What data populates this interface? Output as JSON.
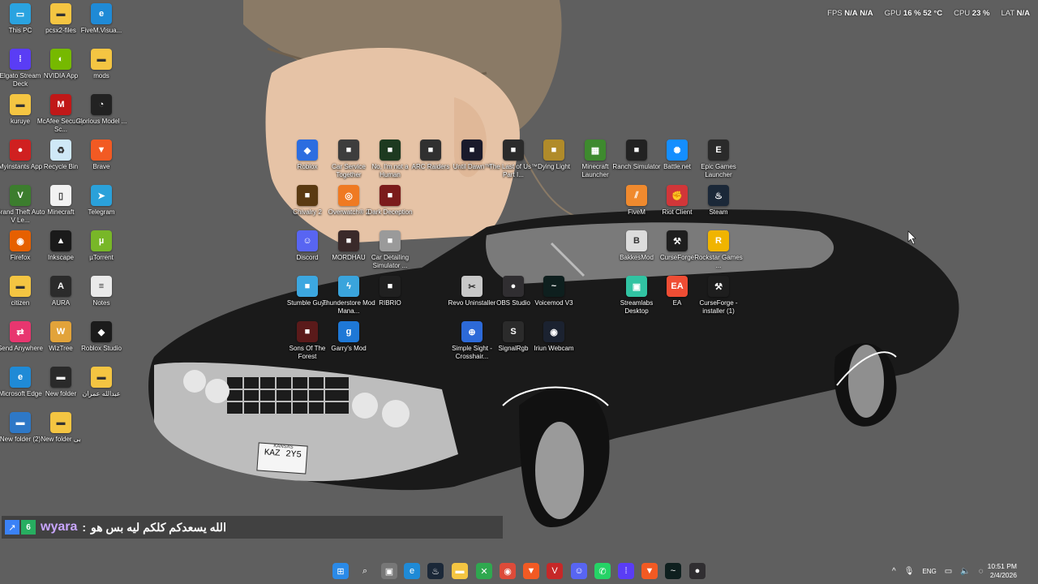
{
  "overlay": {
    "fps_label": "FPS",
    "fps_value": "N/A",
    "fps_value2": "N/A",
    "gpu_label": "GPU",
    "gpu_load": "16 %",
    "gpu_temp": "52 °C",
    "cpu_label": "CPU",
    "cpu_load": "23 %",
    "lat_label": "LAT",
    "lat_value": "N/A"
  },
  "desktop_icons": [
    {
      "label": "This PC",
      "icon": "pc-icon",
      "color": "#2aa3e0"
    },
    {
      "label": "pcsx2-files",
      "icon": "folder-icon",
      "color": "#f4c542"
    },
    {
      "label": "FiveM.Visua...",
      "icon": "edge-icon",
      "color": "#1f8ad6"
    },
    {
      "label": "Elgato Stream Deck",
      "icon": "grid-icon",
      "color": "#5a3df5"
    },
    {
      "label": "NVIDIA App",
      "icon": "nvidia-icon",
      "color": "#76b900"
    },
    {
      "label": "mods",
      "icon": "folder-icon",
      "color": "#f4c542"
    },
    {
      "label": "kuruye",
      "icon": "folder-icon",
      "color": "#f4c542"
    },
    {
      "label": "McAfee Security Sc...",
      "icon": "mcafee-icon",
      "color": "#c01818"
    },
    {
      "label": "Glorious Model ...",
      "icon": "mouse-icon",
      "color": "#222222"
    },
    {
      "label": "Myinstants App",
      "icon": "button-icon",
      "color": "#d02020"
    },
    {
      "label": "Recycle Bin",
      "icon": "recycle-icon",
      "color": "#cfe8f7"
    },
    {
      "label": "Brave",
      "icon": "brave-icon",
      "color": "#f25a23"
    },
    {
      "label": "Grand Theft Auto V Le...",
      "icon": "gta-icon",
      "color": "#3c7d2e"
    },
    {
      "label": "Minecraft",
      "icon": "file-icon",
      "color": "#f2f2f2"
    },
    {
      "label": "Telegram",
      "icon": "telegram-icon",
      "color": "#2aa1da"
    },
    {
      "label": "Firefox",
      "icon": "firefox-icon",
      "color": "#e66000"
    },
    {
      "label": "Inkscape",
      "icon": "inkscape-icon",
      "color": "#1a1a1a"
    },
    {
      "label": "µTorrent",
      "icon": "torrent-icon",
      "color": "#78b728"
    },
    {
      "label": "citizen",
      "icon": "folder-icon",
      "color": "#f4c542"
    },
    {
      "label": "AURA",
      "icon": "aura-icon",
      "color": "#2b2b2b"
    },
    {
      "label": "Notes",
      "icon": "notes-icon",
      "color": "#eaeaea"
    },
    {
      "label": "Send Anywhere",
      "icon": "send-icon",
      "color": "#e8366f"
    },
    {
      "label": "WizTree",
      "icon": "wiztree-icon",
      "color": "#e2a33a"
    },
    {
      "label": "Roblox Studio",
      "icon": "roblox-icon",
      "color": "#1b1b1b"
    },
    {
      "label": "Microsoft Edge",
      "icon": "edge-icon",
      "color": "#1f8ad6"
    },
    {
      "label": "New folder",
      "icon": "folder-icon",
      "color": "#2a2a2a"
    },
    {
      "label": "عبدالله عمران",
      "icon": "folder-icon",
      "color": "#f4c542"
    },
    {
      "label": "New folder (2)",
      "icon": "folder-icon",
      "color": "#2e78c7"
    },
    {
      "label": "New folder بی",
      "icon": "folder-icon",
      "color": "#f4c542"
    },
    {
      "label": "Roblox",
      "icon": "roblox-icon",
      "color": "#2c6de0"
    },
    {
      "label": "Car Service Together",
      "icon": "game-icon",
      "color": "#3d3d3d"
    },
    {
      "label": "No, I'm not a Human",
      "icon": "game-icon",
      "color": "#1d3a20"
    },
    {
      "label": "ARC Raiders",
      "icon": "game-icon",
      "color": "#303030"
    },
    {
      "label": "Until Dawn™",
      "icon": "game-icon",
      "color": "#1a1a2b"
    },
    {
      "label": "The Last of Us™ Part I...",
      "icon": "game-icon",
      "color": "#2b2b2b"
    },
    {
      "label": "Dying Light",
      "icon": "game-icon",
      "color": "#b08b2a"
    },
    {
      "label": "Minecraft Launcher",
      "icon": "minecraft-icon",
      "color": "#3e8a2e"
    },
    {
      "label": "Ranch Simulator",
      "icon": "game-icon",
      "color": "#222222"
    },
    {
      "label": "Battle.net",
      "icon": "battlenet-icon",
      "color": "#148eff"
    },
    {
      "label": "Epic Games Launcher",
      "icon": "epic-icon",
      "color": "#2a2a2a"
    },
    {
      "label": "Chivalry 2",
      "icon": "game-icon",
      "color": "#5a3a12"
    },
    {
      "label": "Overwatch® 2",
      "icon": "overwatch-icon",
      "color": "#ef7a22"
    },
    {
      "label": "Dark Deception",
      "icon": "game-icon",
      "color": "#7b1b1b"
    },
    {
      "label": "FiveM",
      "icon": "fivem-icon",
      "color": "#f08a2e"
    },
    {
      "label": "Riot Client",
      "icon": "riot-icon",
      "color": "#d13639"
    },
    {
      "label": "Steam",
      "icon": "steam-icon",
      "color": "#1b2838"
    },
    {
      "label": "Discord",
      "icon": "discord-icon",
      "color": "#5865f2"
    },
    {
      "label": "MORDHAU",
      "icon": "game-icon",
      "color": "#3a2a2a"
    },
    {
      "label": "Car Detailing Simulator ...",
      "icon": "game-icon",
      "color": "#9a9a9a"
    },
    {
      "label": "BakkesMod",
      "icon": "bakkes-icon",
      "color": "#dcdcdc"
    },
    {
      "label": "CurseForge",
      "icon": "curseforge-icon",
      "color": "#1e1e1e"
    },
    {
      "label": "Rockstar Games ...",
      "icon": "rockstar-icon",
      "color": "#f0b400"
    },
    {
      "label": "Stumble Guys",
      "icon": "game-icon",
      "color": "#3ca7e0"
    },
    {
      "label": "Thunderstore Mod Mana...",
      "icon": "thunder-icon",
      "color": "#3aa4dc"
    },
    {
      "label": "RIBRIO",
      "icon": "game-icon",
      "color": "#202020"
    },
    {
      "label": "Revo Uninstaller",
      "icon": "revo-icon",
      "color": "#c8c8c8"
    },
    {
      "label": "OBS Studio",
      "icon": "obs-icon",
      "color": "#302e31"
    },
    {
      "label": "Voicemod V3",
      "icon": "voicemod-icon",
      "color": "#0e1f1e"
    },
    {
      "label": "Streamlabs Desktop",
      "icon": "streamlabs-icon",
      "color": "#31c3a2"
    },
    {
      "label": "EA",
      "icon": "ea-icon",
      "color": "#ef4d34"
    },
    {
      "label": "CurseForge - installer (1)",
      "icon": "curseforge-icon",
      "color": "#1e1e1e"
    },
    {
      "label": "Sons Of The Forest",
      "icon": "game-icon",
      "color": "#5a1a1a"
    },
    {
      "label": "Garry's Mod",
      "icon": "gmod-icon",
      "color": "#1e78d6"
    },
    {
      "label": "Simple Sight - Crosshair...",
      "icon": "crosshair-icon",
      "color": "#2d6ad8"
    },
    {
      "label": "SignalRgb",
      "icon": "signalrgb-icon",
      "color": "#2b2b2b"
    },
    {
      "label": "Iriun Webcam",
      "icon": "webcam-icon",
      "color": "#1b2230"
    }
  ],
  "chat": {
    "user": "wyara",
    "separator": ":",
    "message": "الله يسعدكم كلكم ليه بس هو"
  },
  "plate": {
    "state": "KANSAS",
    "number": "KAZ 2Y5"
  },
  "taskbar": [
    {
      "name": "start-icon",
      "color": "#2a8ae8",
      "glyph": "⊞"
    },
    {
      "name": "search-icon",
      "color": "transparent",
      "glyph": "⌕"
    },
    {
      "name": "task-view-icon",
      "color": "#777777",
      "glyph": "▣"
    },
    {
      "name": "edge-icon",
      "color": "#1f8ad6",
      "glyph": "e"
    },
    {
      "name": "steam-icon",
      "color": "#1b2838",
      "glyph": "♨"
    },
    {
      "name": "file-explorer-icon",
      "color": "#f4c542",
      "glyph": "▬"
    },
    {
      "name": "xbox-icon",
      "color": "#2fa84f",
      "glyph": "✕"
    },
    {
      "name": "chrome-icon",
      "color": "#dd4b39",
      "glyph": "◉"
    },
    {
      "name": "brave-icon",
      "color": "#f25a23",
      "glyph": "▼"
    },
    {
      "name": "voice-icon",
      "color": "#c62828",
      "glyph": "V"
    },
    {
      "name": "discord-icon",
      "color": "#5865f2",
      "glyph": "☺"
    },
    {
      "name": "whatsapp-icon",
      "color": "#25d366",
      "glyph": "✆"
    },
    {
      "name": "streamdeck-icon",
      "color": "#5a3df5",
      "glyph": "⁞"
    },
    {
      "name": "brave-icon-2",
      "color": "#f25a23",
      "glyph": "▼"
    },
    {
      "name": "voicemod-icon",
      "color": "#0e1f1e",
      "glyph": "~"
    },
    {
      "name": "obs-icon",
      "color": "#302e31",
      "glyph": "●"
    }
  ],
  "tray": {
    "chevron": "^",
    "mic": "🎙",
    "lang": "ENG",
    "time": "10:51 PM",
    "date": "2/4/2026"
  }
}
